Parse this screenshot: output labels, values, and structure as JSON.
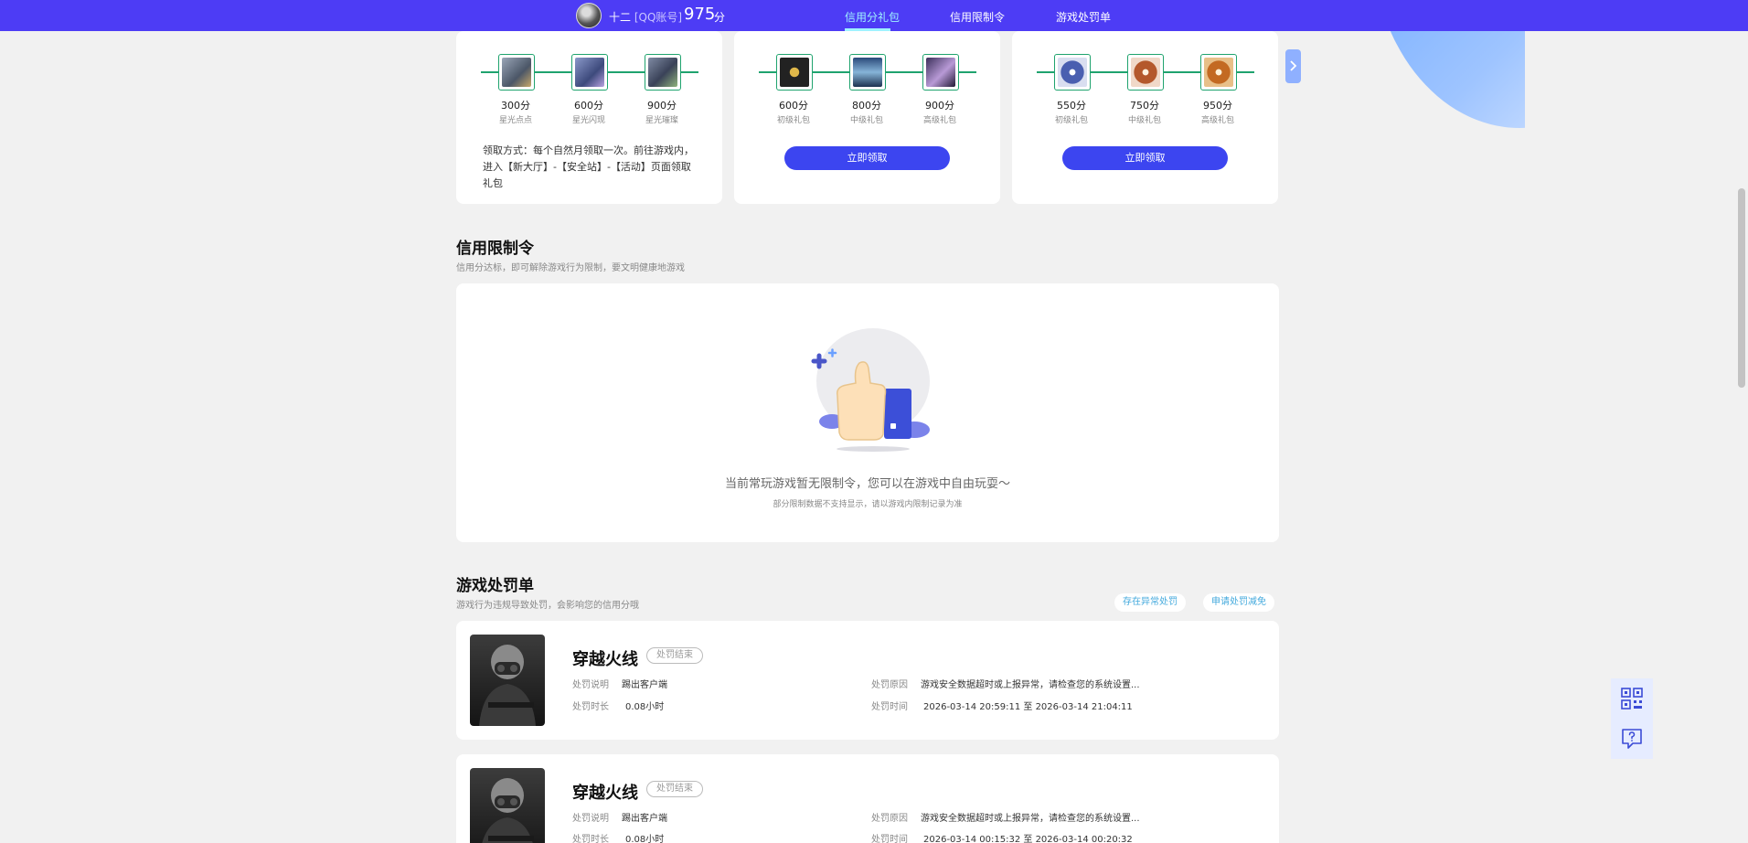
{
  "header": {
    "username": "十二",
    "account_type": "[QQ账号]",
    "score": "975",
    "score_unit": "分",
    "tabs": [
      {
        "label": "信用分礼包",
        "active": true
      },
      {
        "label": "信用限制令",
        "active": false
      },
      {
        "label": "游戏处罚单",
        "active": false
      }
    ]
  },
  "reward_cards": [
    {
      "rewards": [
        {
          "score": "300分",
          "name": "星光点点"
        },
        {
          "score": "600分",
          "name": "星光闪现"
        },
        {
          "score": "900分",
          "name": "星光璀璨"
        }
      ],
      "claim_text": "领取方式：每个自然月领取一次。前往游戏内，进入【新大厅】-【安全站】-【活动】页面领取礼包"
    },
    {
      "rewards": [
        {
          "score": "600分",
          "name": "初级礼包"
        },
        {
          "score": "800分",
          "name": "中级礼包"
        },
        {
          "score": "900分",
          "name": "高级礼包"
        }
      ],
      "button_label": "立即领取"
    },
    {
      "rewards": [
        {
          "score": "550分",
          "name": "初级礼包"
        },
        {
          "score": "750分",
          "name": "中级礼包"
        },
        {
          "score": "950分",
          "name": "高级礼包"
        }
      ],
      "button_label": "立即领取"
    }
  ],
  "restrictions": {
    "title": "信用限制令",
    "subtitle": "信用分达标，即可解除游戏行为限制，要文明健康地游戏",
    "empty_main": "当前常玩游戏暂无限制令，您可以在游戏中自由玩耍～",
    "empty_sub": "部分限制数据不支持显示，请以游戏内限制记录为准"
  },
  "penalties": {
    "title": "游戏处罚单",
    "subtitle": "游戏行为违规导致处罚，会影响您的信用分哦",
    "btn_abnormal": "存在异常处罚",
    "btn_appeal": "申请处罚减免",
    "labels": {
      "desc": "处罚说明",
      "duration": "处罚时长",
      "reason": "处罚原因",
      "time": "处罚时间"
    },
    "items": [
      {
        "game": "穿越火线",
        "status": "处罚结束",
        "desc": "踢出客户端",
        "duration": "0.08小时",
        "reason": "游戏安全数据超时或上报异常，请检查您的系统设置...",
        "time": "2026-03-14 20:59:11 至 2026-03-14 21:04:11"
      },
      {
        "game": "穿越火线",
        "status": "处罚结束",
        "desc": "踢出客户端",
        "duration": "0.08小时",
        "reason": "游戏安全数据超时或上报异常，请检查您的系统设置...",
        "time": "2026-03-14 00:15:32 至 2026-03-14 00:20:32"
      }
    ]
  },
  "icons": {
    "next": "chevron-right-icon",
    "qr": "qr-code-icon",
    "help": "help-chat-icon"
  }
}
